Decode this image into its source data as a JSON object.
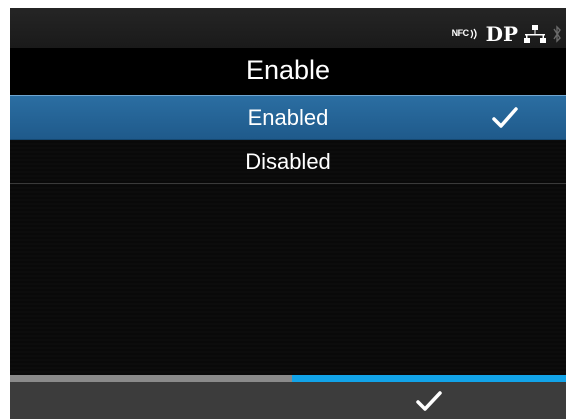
{
  "status": {
    "nfc_label": "NFC",
    "dp_label": "DP",
    "icons": [
      "nfc-icon",
      "dp-icon",
      "network-icon",
      "bluetooth-icon"
    ]
  },
  "title": "Enable",
  "menu": {
    "items": [
      {
        "label": "Enabled",
        "selected": true
      },
      {
        "label": "Disabled",
        "selected": false
      }
    ]
  },
  "softkeys": {
    "left": {
      "label": "",
      "accent": "#8a8a8a"
    },
    "right": {
      "icon": "check-icon",
      "accent": "#12a3e8"
    }
  },
  "colors": {
    "selected_row": "#2465a0",
    "accent_blue": "#12a3e8",
    "background": "#000000"
  }
}
